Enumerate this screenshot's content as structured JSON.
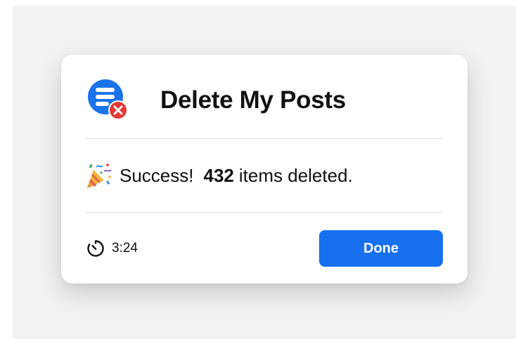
{
  "dialog": {
    "title": "Delete My Posts",
    "app_icon": "list-delete-icon",
    "message": {
      "emoji_icon": "party-popper-icon",
      "prefix": "Success!",
      "count": "432",
      "suffix": "items deleted."
    },
    "timer": {
      "icon": "timer-icon",
      "value": "3:24"
    },
    "done_label": "Done"
  },
  "colors": {
    "accent": "#1670f0",
    "app_icon_blue": "#1a73e8",
    "error_red": "#e53935",
    "backdrop": "#f2f2f2"
  }
}
